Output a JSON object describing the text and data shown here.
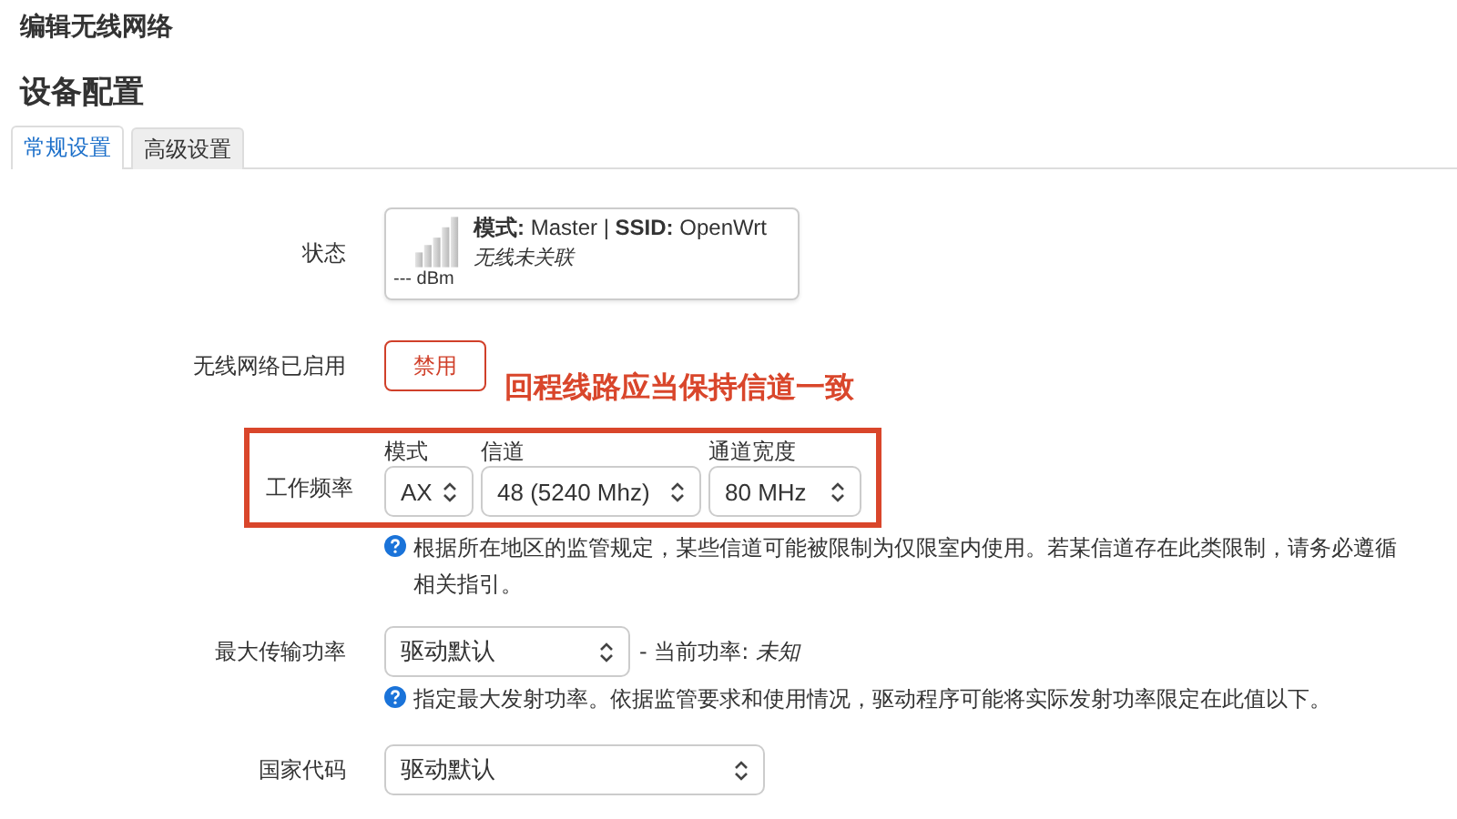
{
  "page_title": "编辑无线网络",
  "section_title": "设备配置",
  "tabs": [
    {
      "label": "常规设置",
      "selected": true
    },
    {
      "label": "高级设置",
      "selected": false
    }
  ],
  "annotation": {
    "text": "回程线路应当保持信道一致"
  },
  "fields": [
    {
      "kind": "status",
      "label": "状态",
      "mode_label": "模式:",
      "mode": "Master",
      "separator": "|",
      "ssid_label": "SSID:",
      "ssid": "OpenWrt",
      "note": "无线未关联",
      "signal": "--- dBm"
    },
    {
      "kind": "button",
      "label": "无线网络已启用",
      "button": "禁用"
    },
    {
      "kind": "frequency",
      "label": "工作频率",
      "highlighted": true,
      "selects": [
        {
          "label": "模式",
          "value": "AX"
        },
        {
          "label": "信道",
          "value": "48 (5240 Mhz)"
        },
        {
          "label": "通道宽度",
          "value": "80 MHz"
        }
      ],
      "help": "根据所在地区的监管规定，某些信道可能被限制为仅限室内使用。若某信道存在此类限制，请务必遵循相关指引。"
    },
    {
      "kind": "select",
      "label": "最大传输功率",
      "value": "驱动默认",
      "suffix": "- 当前功率:",
      "suffix_value": "未知",
      "help": "指定最大发射功率。依据监管要求和使用情况，驱动程序可能将实际发射功率限定在此值以下。"
    },
    {
      "kind": "select",
      "label": "国家代码",
      "value": "驱动默认"
    }
  ]
}
